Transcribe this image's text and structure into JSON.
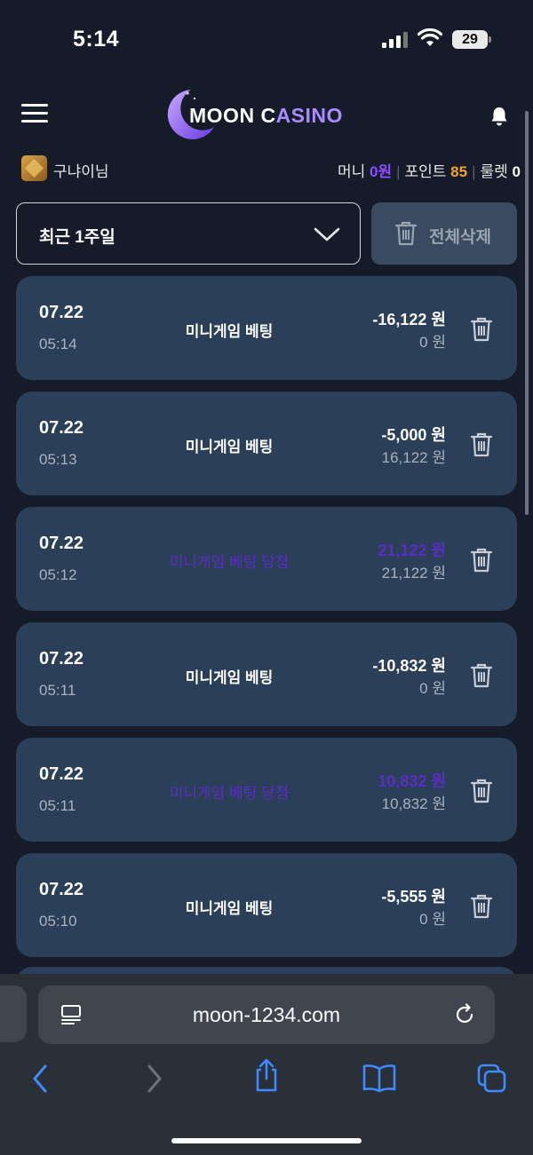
{
  "status_bar": {
    "time": "5:14",
    "battery": "29"
  },
  "header": {
    "logo_main": "MOON C",
    "logo_accent": "ASINO",
    "menu_icon": "hamburger-icon",
    "bell_icon": "bell-icon"
  },
  "user": {
    "name": "구냐이님",
    "money_label": "머니",
    "money_value": "0원",
    "point_label": "포인트",
    "point_value": "85",
    "roulette_label": "룰렛",
    "roulette_value": "0"
  },
  "filter": {
    "period": "최근 1주일",
    "delete_all": "전체삭제"
  },
  "transactions": [
    {
      "date": "07.22",
      "time": "05:14",
      "desc": "미니게임 베팅",
      "amount": "-16,122 원",
      "balance": "0 원",
      "highlight": false
    },
    {
      "date": "07.22",
      "time": "05:13",
      "desc": "미니게임 베팅",
      "amount": "-5,000 원",
      "balance": "16,122 원",
      "highlight": false
    },
    {
      "date": "07.22",
      "time": "05:12",
      "desc": "미니게임 베팅 당첨",
      "amount": "21,122 원",
      "balance": "21,122 원",
      "highlight": true
    },
    {
      "date": "07.22",
      "time": "05:11",
      "desc": "미니게임 베팅",
      "amount": "-10,832 원",
      "balance": "0 원",
      "highlight": false
    },
    {
      "date": "07.22",
      "time": "05:11",
      "desc": "미니게임 베팅 당첨",
      "amount": "10,832 원",
      "balance": "10,832 원",
      "highlight": true
    },
    {
      "date": "07.22",
      "time": "05:10",
      "desc": "미니게임 베팅",
      "amount": "-5,555 원",
      "balance": "0 원",
      "highlight": false
    }
  ],
  "browser": {
    "url": "moon-1234.com"
  },
  "colors": {
    "background": "#151b29",
    "card": "#2b3f58",
    "accent_purple": "#8a4dff",
    "point_orange": "#f2a52a"
  }
}
